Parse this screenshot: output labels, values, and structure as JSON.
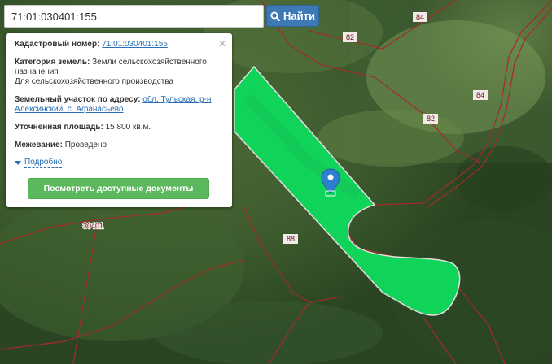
{
  "search": {
    "value": "71:01:030401:155",
    "button_label": "Найти"
  },
  "popup": {
    "cadastral_label": "Кадастровый номер:",
    "cadastral_value": "71:01:030401:155",
    "category_label": "Категория земель:",
    "category_value": "Земли сельскохозяйственного назначения",
    "category_use": "Для сельскохозяйственного производства",
    "address_label": "Земельный участок по адресу:",
    "address_value": "обл. Тульская, р-н Алексинский, с. Афанасьево",
    "area_label": "Уточненная площадь:",
    "area_value": "15 800 кв.м.",
    "survey_label": "Межевание:",
    "survey_value": "Проведено",
    "more_link": "Подробно",
    "docs_button": "Посмотреть доступные документы",
    "close_icon": "×"
  },
  "map": {
    "parcel_labels": [
      "84",
      "82",
      "84",
      "82",
      "88",
      "30401"
    ],
    "parcel_color": "#10d35a",
    "boundary_color": "#a52a2a",
    "marker_color": "#2f7fd0"
  }
}
